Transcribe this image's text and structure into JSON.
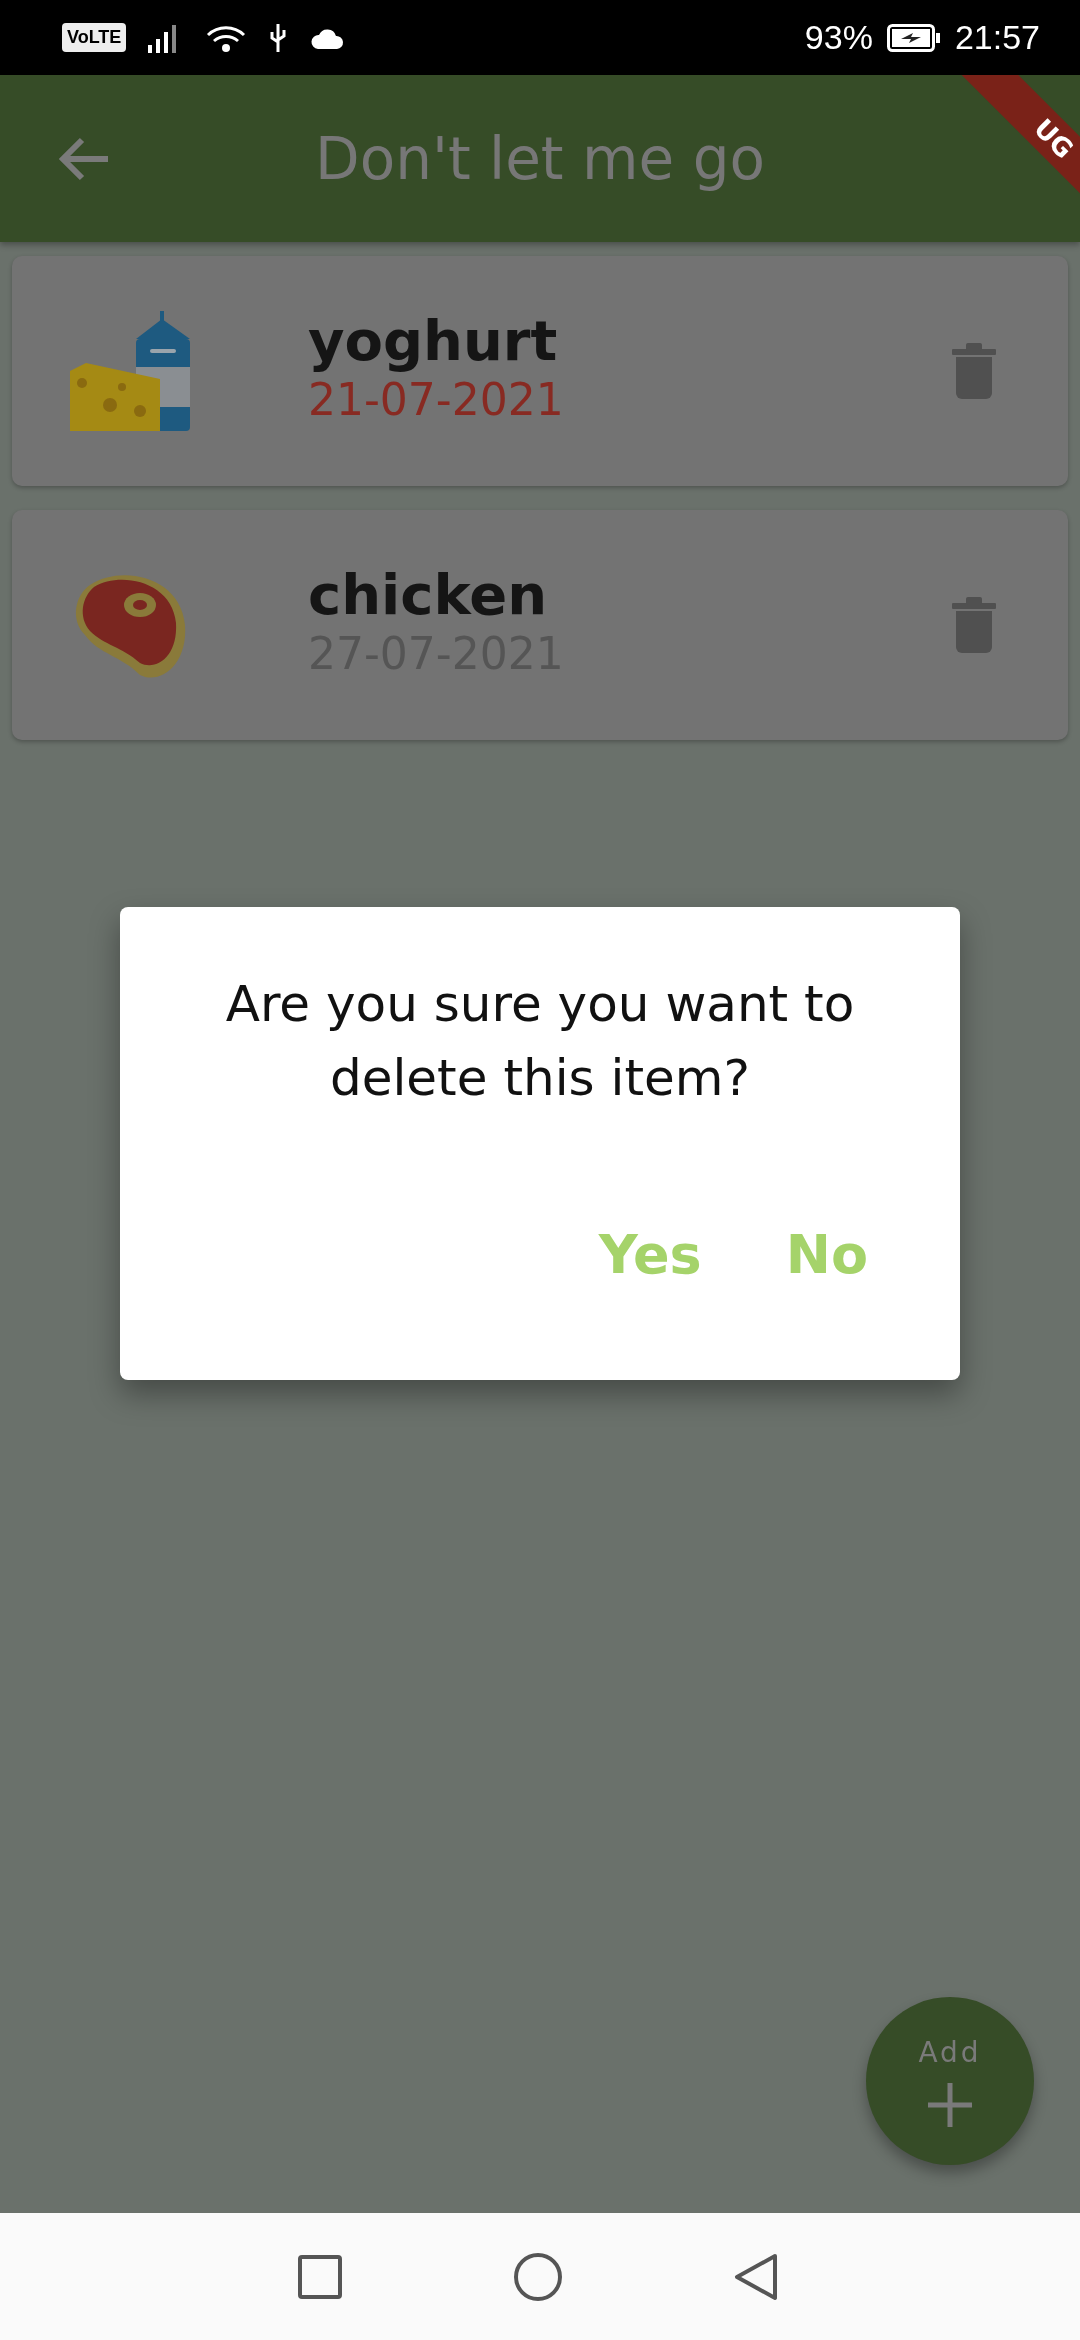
{
  "status_bar": {
    "network_badge": "VoLTE",
    "battery_percent": "93%",
    "charging": true,
    "time": "21:57"
  },
  "app_bar": {
    "title": "Don't let me go",
    "debug_ribbon": "UG"
  },
  "items": [
    {
      "name": "yoghurt",
      "date": "21-07-2021",
      "expired": true,
      "kind": "dairy"
    },
    {
      "name": "chicken",
      "date": "27-07-2021",
      "expired": false,
      "kind": "meat"
    }
  ],
  "dialog": {
    "message": "Are you sure you want to delete this item?",
    "buttons": [
      "Yes",
      "No"
    ]
  },
  "fab": {
    "label": "Add"
  }
}
